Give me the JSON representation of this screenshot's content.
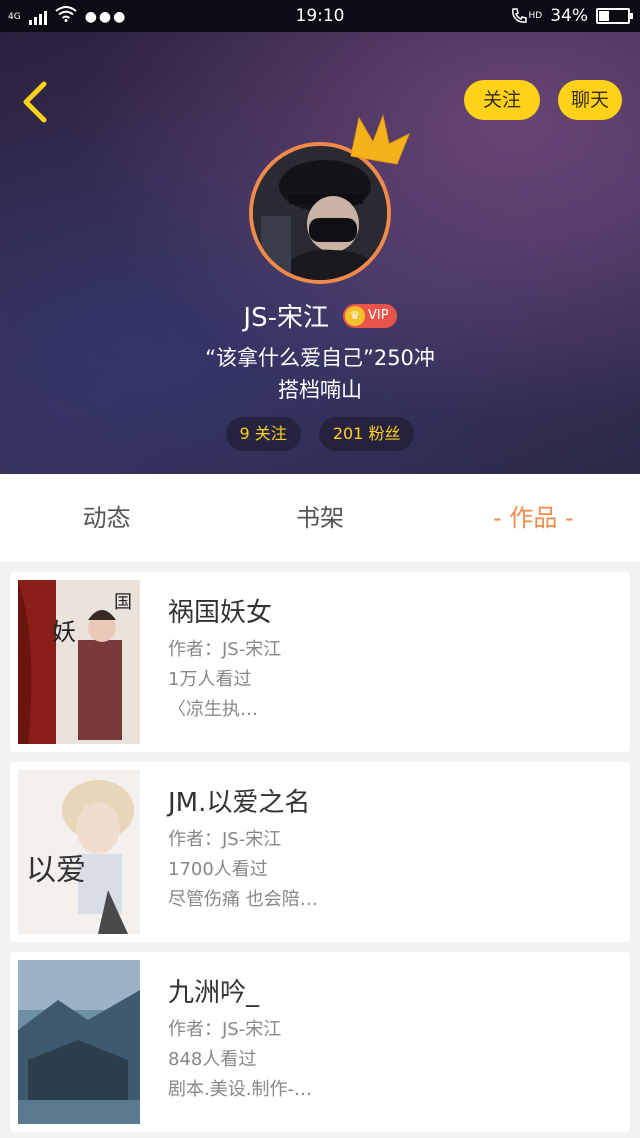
{
  "status_bar": {
    "network": "4G",
    "time": "19:10",
    "hd": "HD",
    "battery": "34%",
    "battery_level": 0.34
  },
  "header": {
    "follow_label": "关注",
    "chat_label": "聊天",
    "username": "JS-宋江",
    "vip_label": "VIP",
    "bio_line1": "“该拿什么爱自己”250冲",
    "bio_line2": "搭档喃山",
    "following": "9 关注",
    "fans": "201 粉丝"
  },
  "tabs": [
    {
      "label": "动态",
      "active": false
    },
    {
      "label": "书架",
      "active": false
    },
    {
      "label": "- 作品 -",
      "active": true
    }
  ],
  "works": [
    {
      "title": "祸国妖女",
      "author": "作者：JS-宋江",
      "views": "1万人看过",
      "desc": "〈凉生执…"
    },
    {
      "title": "JM.以爱之名",
      "author": "作者：JS-宋江",
      "views": "1700人看过",
      "desc": "尽管伤痛 也会陪…"
    },
    {
      "title": "九洲吟_",
      "author": "作者：JS-宋江",
      "views": "848人看过",
      "desc": "剧本.美设.制作-…"
    }
  ],
  "colors": {
    "accent": "#f08a4a",
    "yellow": "#ffd21a",
    "vip_red": "#e8534a"
  }
}
